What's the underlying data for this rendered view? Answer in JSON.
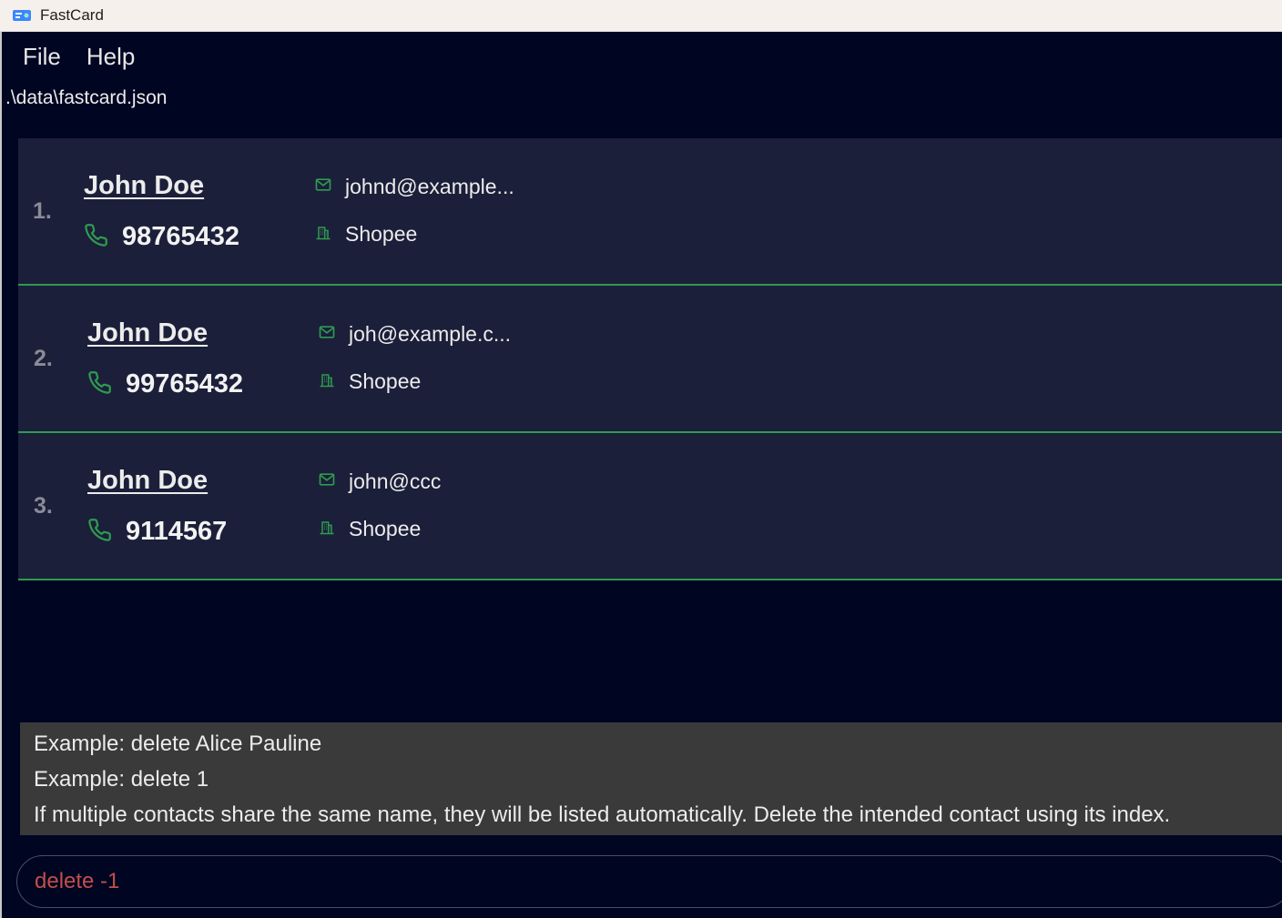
{
  "window": {
    "title": "FastCard",
    "icon": "fastcard-app-icon"
  },
  "menu": {
    "items": [
      {
        "label": "File"
      },
      {
        "label": "Help"
      }
    ]
  },
  "file_path": ".\\data\\fastcard.json",
  "contacts": [
    {
      "index": "1.",
      "name": "John Doe",
      "phone": "98765432",
      "email": "johnd@example...",
      "organization": "Shopee"
    },
    {
      "index": "2.",
      "name": "John Doe",
      "phone": "99765432",
      "email": "joh@example.c...",
      "organization": "Shopee"
    },
    {
      "index": "3.",
      "name": "John Doe",
      "phone": "9114567",
      "email": "john@ccc",
      "organization": "Shopee"
    }
  ],
  "result": {
    "lines": [
      "Example: delete Alice Pauline",
      "Example: delete 1",
      "If multiple contacts share the same name, they will be listed automatically. Delete the intended contact using its index."
    ]
  },
  "command": {
    "value": "delete -1"
  },
  "icons": {
    "phone": "phone-icon",
    "email": "mail-icon",
    "organization": "building-icon"
  },
  "colors": {
    "accent_green": "#2f9a4f",
    "error_text": "#c0504a",
    "card_bg": "#1b1f3a",
    "app_bg": "#000522"
  }
}
